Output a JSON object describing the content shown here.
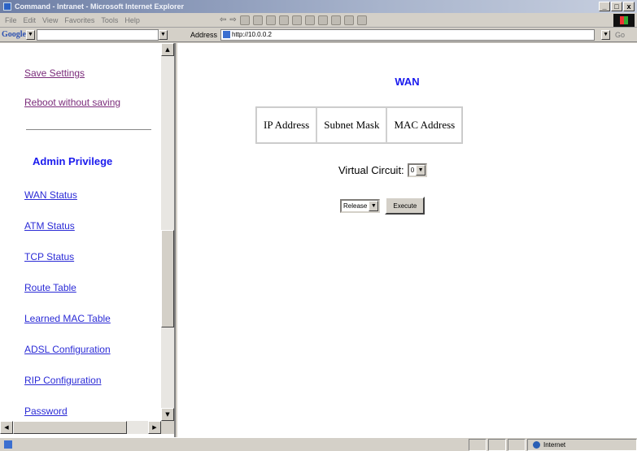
{
  "window": {
    "title": "Command - Intranet - Microsoft Internet Explorer",
    "minimize": "_",
    "maximize": "□",
    "close": "x"
  },
  "menu": [
    "File",
    "Edit",
    "View",
    "Favorites",
    "Tools",
    "Help"
  ],
  "toolbar": {
    "google_label": "Google",
    "address_label": "Address",
    "address_value": "http://10.0.0.2",
    "go_label": "Go"
  },
  "sidebar": {
    "save_settings": "Save Settings",
    "reboot": "Reboot without saving",
    "section_title": "Admin Privilege",
    "links": [
      "WAN Status",
      "ATM Status",
      "TCP Status",
      "Route Table",
      "Learned MAC Table",
      "ADSL Configuration",
      "RIP Configuration",
      "Password"
    ]
  },
  "main": {
    "title": "WAN",
    "table_headers": [
      "IP Address",
      "Subnet Mask",
      "MAC Address"
    ],
    "virtual_circuit_label": "Virtual Circuit:",
    "virtual_circuit_value": "0",
    "action_value": "Release",
    "execute_label": "Execute"
  },
  "statusbar": {
    "zone": "Internet"
  }
}
